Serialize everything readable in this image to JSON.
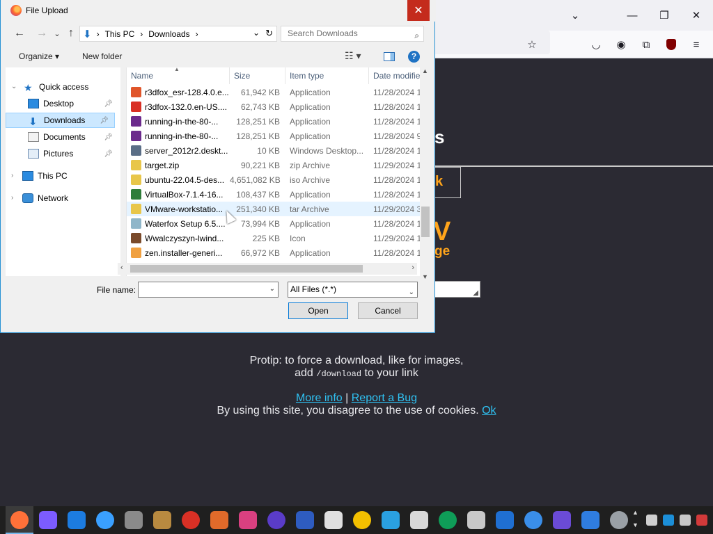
{
  "dialog": {
    "title": "File Upload",
    "close": "✕"
  },
  "address": {
    "back": "←",
    "forward": "→",
    "recent": "⌄",
    "up": "↑",
    "path": [
      "This PC",
      "Downloads"
    ],
    "sep": "›",
    "refresh": "↻",
    "dropdown": "⌄",
    "search_placeholder": "Search Downloads"
  },
  "toolbar": {
    "organize": "Organize ▾",
    "new_folder": "New folder",
    "help": "?"
  },
  "nav_pane": {
    "quick_access": "Quick access",
    "desktop": "Desktop",
    "downloads": "Downloads",
    "documents": "Documents",
    "pictures": "Pictures",
    "this_pc": "This PC",
    "network": "Network"
  },
  "columns": {
    "name": "Name",
    "size": "Size",
    "type": "Item type",
    "date": "Date modifie"
  },
  "files": [
    {
      "name": "r3dfox_esr-128.4.0.e...",
      "size": "61,942 KB",
      "type": "Application",
      "date": "11/28/2024 1",
      "color": "#e0552a"
    },
    {
      "name": "r3dfox-132.0.en-US....",
      "size": "62,743 KB",
      "type": "Application",
      "date": "11/28/2024 1",
      "color": "#d93025"
    },
    {
      "name": "running-in-the-80-...",
      "size": "128,251 KB",
      "type": "Application",
      "date": "11/28/2024 1",
      "color": "#6b2a8c"
    },
    {
      "name": "running-in-the-80-...",
      "size": "128,251 KB",
      "type": "Application",
      "date": "11/28/2024 9",
      "color": "#6b2a8c"
    },
    {
      "name": "server_2012r2.deskt...",
      "size": "10 KB",
      "type": "Windows Desktop...",
      "date": "11/28/2024 1",
      "color": "#5a6e86"
    },
    {
      "name": "target.zip",
      "size": "90,221 KB",
      "type": "zip Archive",
      "date": "11/29/2024 1",
      "color": "#e8c64a"
    },
    {
      "name": "ubuntu-22.04.5-des...",
      "size": "4,651,082 KB",
      "type": "iso Archive",
      "date": "11/28/2024 1",
      "color": "#e8c64a"
    },
    {
      "name": "VirtualBox-7.1.4-16...",
      "size": "108,437 KB",
      "type": "Application",
      "date": "11/28/2024 1",
      "color": "#2f7d3a"
    },
    {
      "name": "VMware-workstatio...",
      "size": "251,340 KB",
      "type": "tar Archive",
      "date": "11/29/2024 3",
      "color": "#e8c64a"
    },
    {
      "name": "Waterfox Setup 6.5....",
      "size": "73,994 KB",
      "type": "Application",
      "date": "11/28/2024 1",
      "color": "#8fb6c9"
    },
    {
      "name": "Wwalczyszyn-lwind...",
      "size": "225 KB",
      "type": "Icon",
      "date": "11/29/2024 1",
      "color": "#7a4a2a"
    },
    {
      "name": "zen.installer-generi...",
      "size": "66,972 KB",
      "type": "Application",
      "date": "11/28/2024 1",
      "color": "#f0a040"
    }
  ],
  "bottom": {
    "file_name_label": "File name:",
    "file_name_value": "",
    "file_type": "All Files (*.*)",
    "open": "Open",
    "cancel": "Cancel"
  },
  "webpage": {
    "heading_fragment": "s",
    "box_fragment": "k",
    "orange_big": "V",
    "orange_small": "ge",
    "protip_line1": "Protip: to force a download, like for images,",
    "protip_line2_pre": "add",
    "protip_code": "/download",
    "protip_line2_post": "to your link",
    "more_info": "More info",
    "divider": "|",
    "report_bug": "Report a Bug",
    "cookies_text": "By using this site, you disagree to the use of cookies.",
    "ok": "Ok"
  },
  "colors": {
    "accent": "#0078d7",
    "selection": "#cce8ff",
    "close_red": "#c42b1c",
    "site_orange": "#ffa41b",
    "site_link": "#2fc2f3"
  }
}
